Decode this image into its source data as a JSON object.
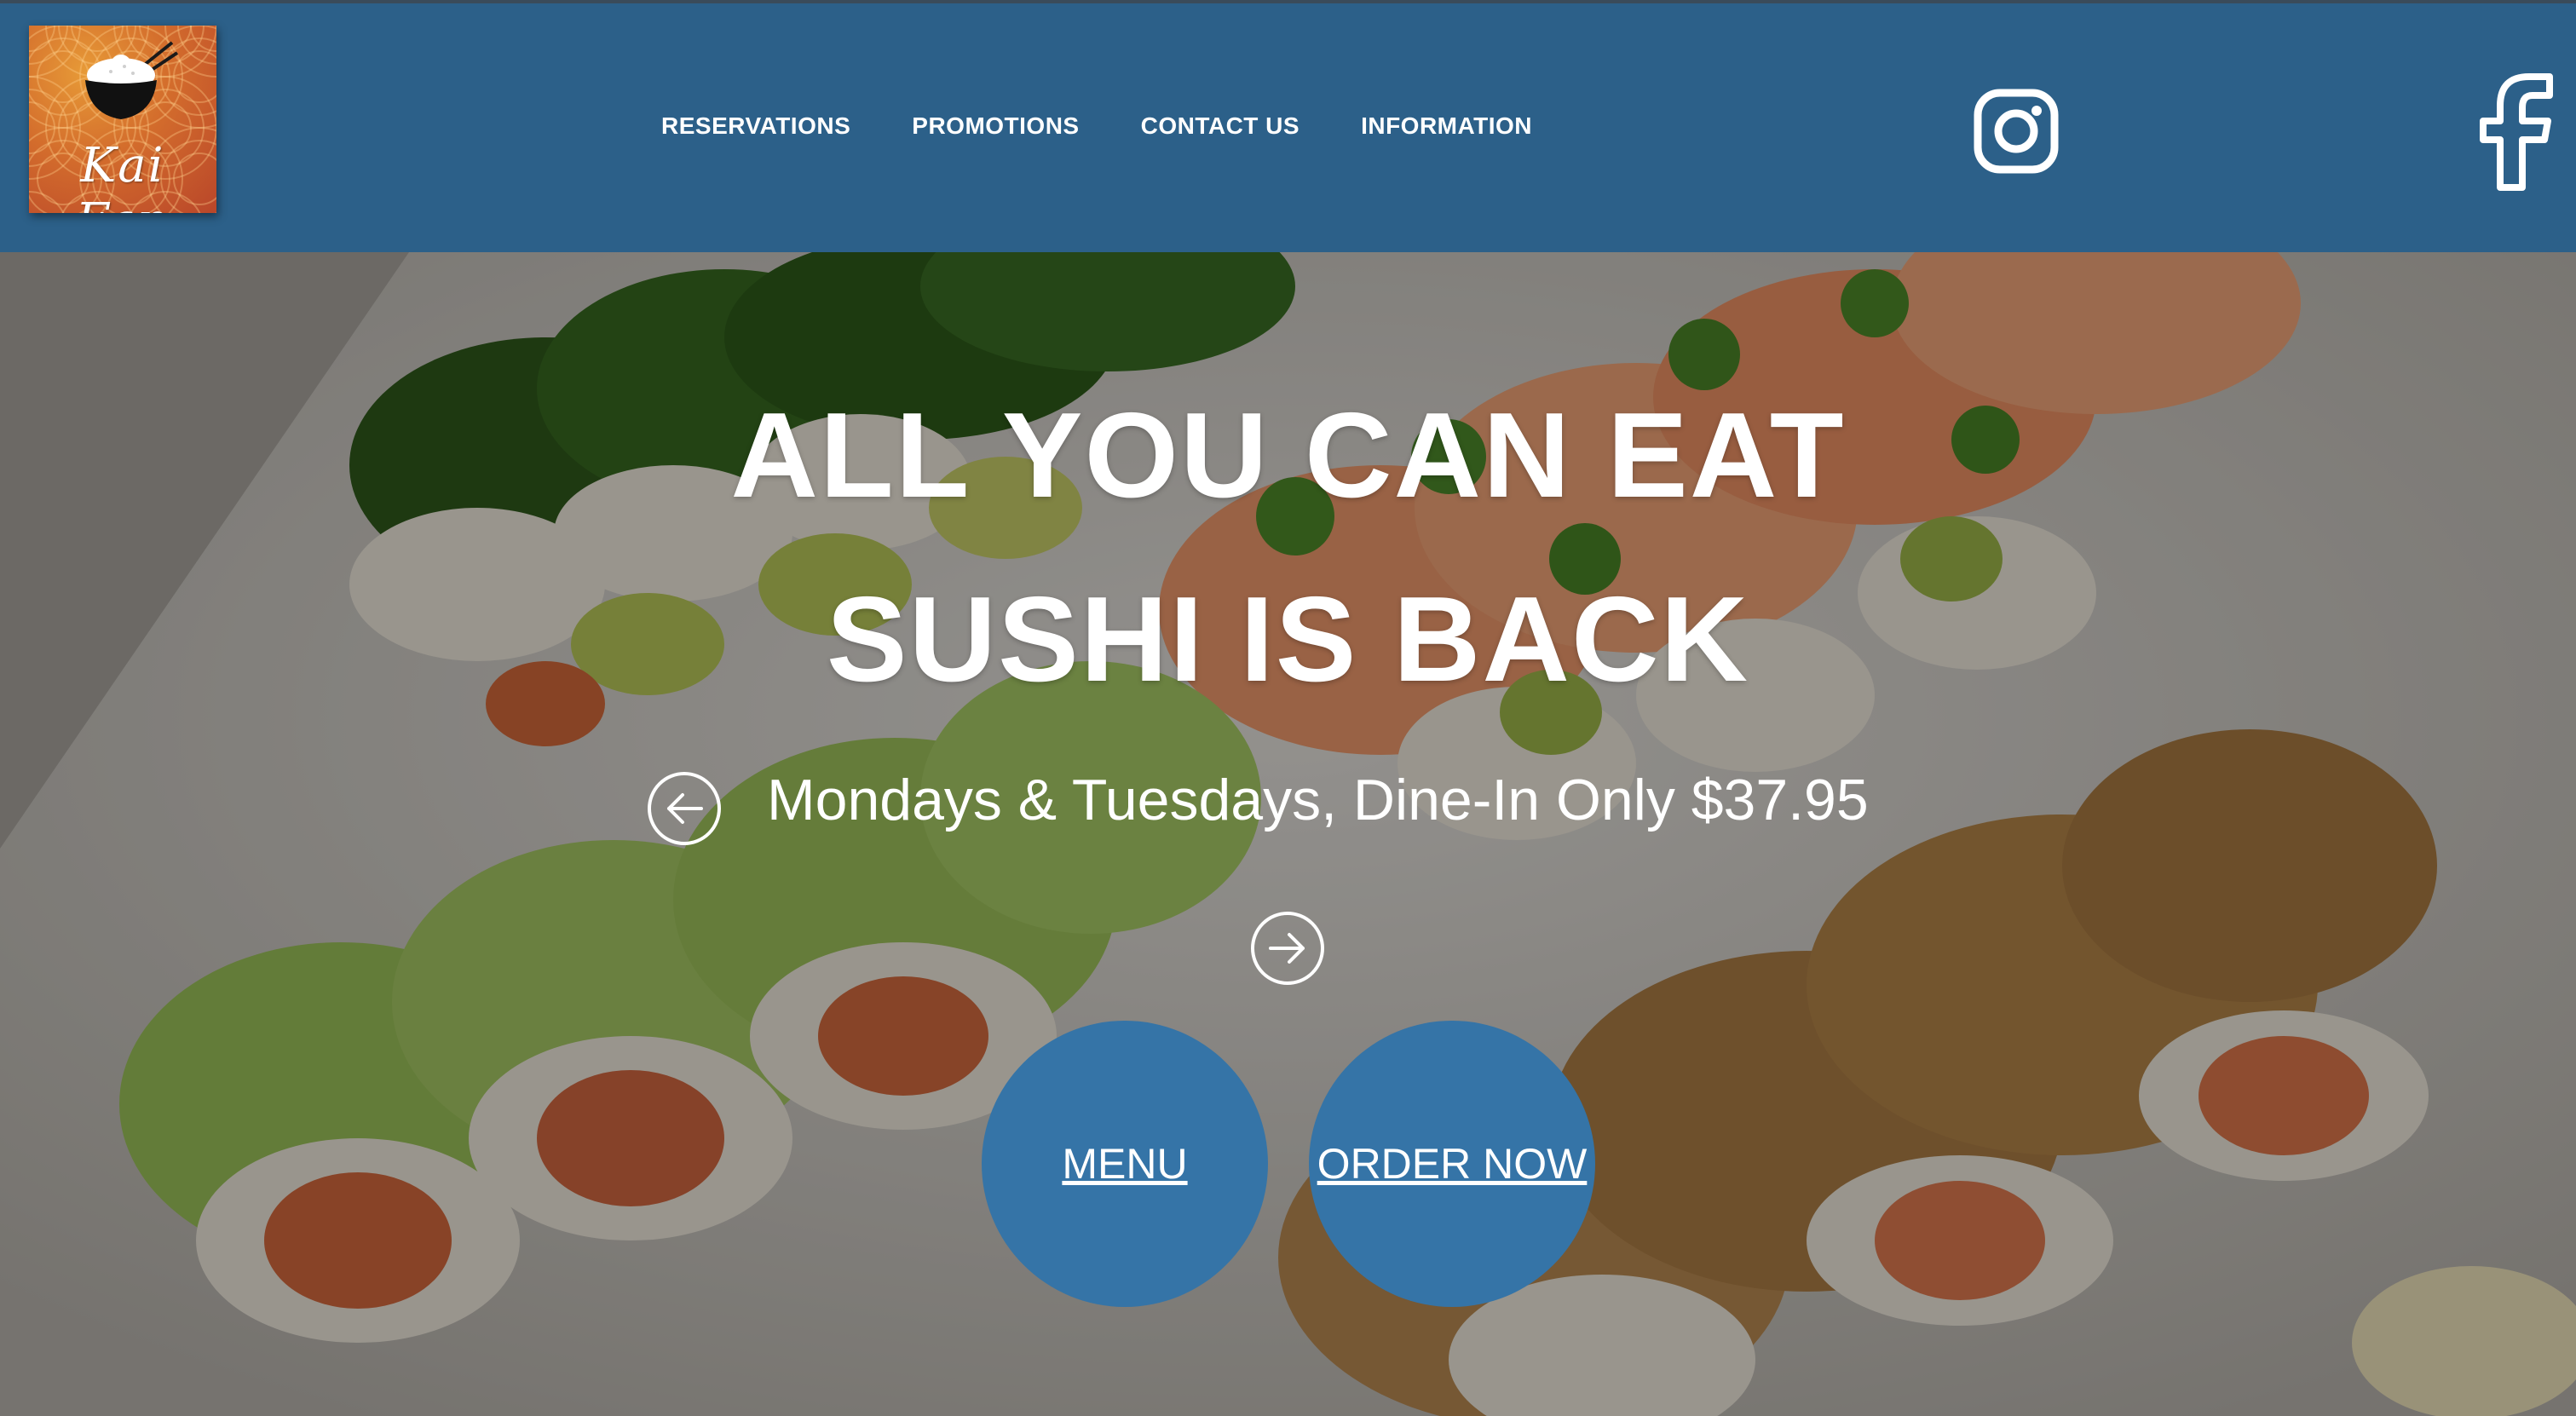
{
  "brand": {
    "logo_text": "Kai Fan"
  },
  "nav": {
    "items": [
      {
        "label": "RESERVATIONS"
      },
      {
        "label": "PROMOTIONS"
      },
      {
        "label": "CONTACT US"
      },
      {
        "label": "INFORMATION"
      }
    ]
  },
  "social": {
    "instagram_icon": "instagram-icon",
    "facebook_icon": "facebook-icon"
  },
  "hero": {
    "headline_line1": "ALL YOU CAN EAT",
    "headline_line2": "SUSHI IS BACK",
    "subline": "Mondays & Tuesdays, Dine-In Only $37.95",
    "prev_icon": "arrow-left-circle-icon",
    "next_icon": "arrow-right-circle-icon",
    "menu_button": "MENU",
    "order_button": "ORDER NOW"
  },
  "colors": {
    "header_bg": "#2c6089",
    "button_bg": "#3574a7",
    "text": "#ffffff"
  }
}
